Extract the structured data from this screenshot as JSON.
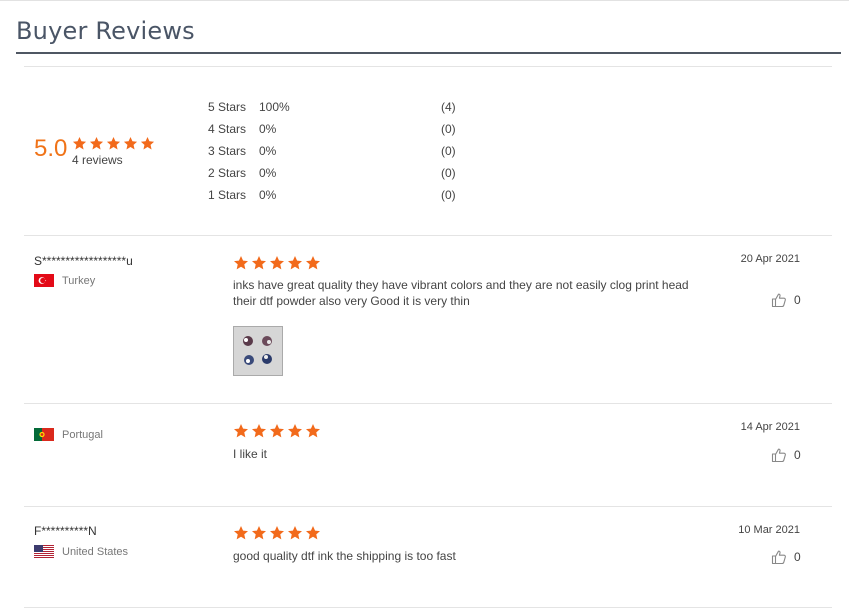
{
  "header": {
    "title": "Buyer Reviews"
  },
  "summary": {
    "score": "5.0",
    "stars": 5,
    "reviews_label": "4 reviews",
    "distribution": [
      {
        "label": "5 Stars",
        "percent": "100%",
        "count": "(4)"
      },
      {
        "label": "4 Stars",
        "percent": "0%",
        "count": "(0)"
      },
      {
        "label": "3 Stars",
        "percent": "0%",
        "count": "(0)"
      },
      {
        "label": "2 Stars",
        "percent": "0%",
        "count": "(0)"
      },
      {
        "label": "1 Stars",
        "percent": "0%",
        "count": "(0)"
      }
    ]
  },
  "reviews": [
    {
      "name": "S******************u",
      "country": "Turkey",
      "flag_icon": "turkey-flag-icon",
      "rating": 5,
      "text": "inks have great quality they have vibrant colors and they are not easily clog print head their dtf powder also very Good it is very thin",
      "date": "20 Apr 2021",
      "likes": "0",
      "has_photo": true
    },
    {
      "name": "",
      "country": "Portugal",
      "flag_icon": "portugal-flag-icon",
      "rating": 5,
      "text": "I like it",
      "date": "14 Apr 2021",
      "likes": "0",
      "has_photo": false
    },
    {
      "name": "F**********N",
      "country": "United States",
      "flag_icon": "us-flag-icon",
      "rating": 5,
      "text": "good quality dtf ink the shipping is too fast",
      "date": "10 Mar 2021",
      "likes": "0",
      "has_photo": false
    }
  ],
  "colors": {
    "accent": "#f07318",
    "star": "#f26a1b",
    "title": "#4a5566"
  }
}
